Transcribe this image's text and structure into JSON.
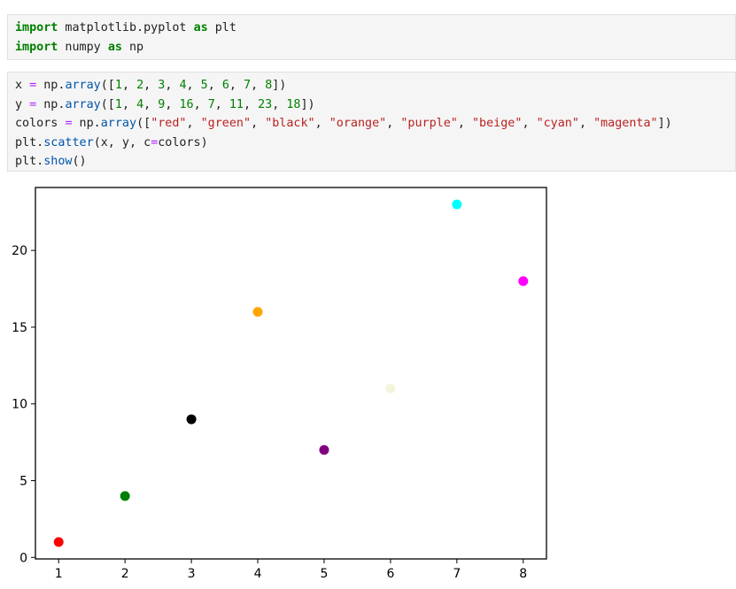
{
  "cells": [
    {
      "lines": [
        [
          {
            "t": "kw",
            "v": "import"
          },
          {
            "t": "plain",
            "v": " matplotlib.pyplot "
          },
          {
            "t": "kw",
            "v": "as"
          },
          {
            "t": "plain",
            "v": " plt"
          }
        ],
        [
          {
            "t": "kw",
            "v": "import"
          },
          {
            "t": "plain",
            "v": " numpy "
          },
          {
            "t": "kw",
            "v": "as"
          },
          {
            "t": "plain",
            "v": " np"
          }
        ]
      ]
    },
    {
      "lines": [
        [
          {
            "t": "plain",
            "v": "x "
          },
          {
            "t": "op",
            "v": "="
          },
          {
            "t": "plain",
            "v": " np."
          },
          {
            "t": "fn",
            "v": "array"
          },
          {
            "t": "plain",
            "v": "(["
          },
          {
            "t": "num",
            "v": "1"
          },
          {
            "t": "plain",
            "v": ", "
          },
          {
            "t": "num",
            "v": "2"
          },
          {
            "t": "plain",
            "v": ", "
          },
          {
            "t": "num",
            "v": "3"
          },
          {
            "t": "plain",
            "v": ", "
          },
          {
            "t": "num",
            "v": "4"
          },
          {
            "t": "plain",
            "v": ", "
          },
          {
            "t": "num",
            "v": "5"
          },
          {
            "t": "plain",
            "v": ", "
          },
          {
            "t": "num",
            "v": "6"
          },
          {
            "t": "plain",
            "v": ", "
          },
          {
            "t": "num",
            "v": "7"
          },
          {
            "t": "plain",
            "v": ", "
          },
          {
            "t": "num",
            "v": "8"
          },
          {
            "t": "plain",
            "v": "])"
          }
        ],
        [
          {
            "t": "plain",
            "v": "y "
          },
          {
            "t": "op",
            "v": "="
          },
          {
            "t": "plain",
            "v": " np."
          },
          {
            "t": "fn",
            "v": "array"
          },
          {
            "t": "plain",
            "v": "(["
          },
          {
            "t": "num",
            "v": "1"
          },
          {
            "t": "plain",
            "v": ", "
          },
          {
            "t": "num",
            "v": "4"
          },
          {
            "t": "plain",
            "v": ", "
          },
          {
            "t": "num",
            "v": "9"
          },
          {
            "t": "plain",
            "v": ", "
          },
          {
            "t": "num",
            "v": "16"
          },
          {
            "t": "plain",
            "v": ", "
          },
          {
            "t": "num",
            "v": "7"
          },
          {
            "t": "plain",
            "v": ", "
          },
          {
            "t": "num",
            "v": "11"
          },
          {
            "t": "plain",
            "v": ", "
          },
          {
            "t": "num",
            "v": "23"
          },
          {
            "t": "plain",
            "v": ", "
          },
          {
            "t": "num",
            "v": "18"
          },
          {
            "t": "plain",
            "v": "])"
          }
        ],
        [
          {
            "t": "plain",
            "v": "colors "
          },
          {
            "t": "op",
            "v": "="
          },
          {
            "t": "plain",
            "v": " np."
          },
          {
            "t": "fn",
            "v": "array"
          },
          {
            "t": "plain",
            "v": "(["
          },
          {
            "t": "str",
            "v": "\"red\""
          },
          {
            "t": "plain",
            "v": ", "
          },
          {
            "t": "str",
            "v": "\"green\""
          },
          {
            "t": "plain",
            "v": ", "
          },
          {
            "t": "str",
            "v": "\"black\""
          },
          {
            "t": "plain",
            "v": ", "
          },
          {
            "t": "str",
            "v": "\"orange\""
          },
          {
            "t": "plain",
            "v": ", "
          },
          {
            "t": "str",
            "v": "\"purple\""
          },
          {
            "t": "plain",
            "v": ", "
          },
          {
            "t": "str",
            "v": "\"beige\""
          },
          {
            "t": "plain",
            "v": ", "
          },
          {
            "t": "str",
            "v": "\"cyan\""
          },
          {
            "t": "plain",
            "v": ", "
          },
          {
            "t": "str",
            "v": "\"magenta\""
          },
          {
            "t": "plain",
            "v": "])"
          }
        ],
        [
          {
            "t": "plain",
            "v": "plt."
          },
          {
            "t": "fn",
            "v": "scatter"
          },
          {
            "t": "plain",
            "v": "(x, y, c"
          },
          {
            "t": "op",
            "v": "="
          },
          {
            "t": "plain",
            "v": "colors)"
          }
        ],
        [
          {
            "t": "plain",
            "v": "plt."
          },
          {
            "t": "fn",
            "v": "show"
          },
          {
            "t": "plain",
            "v": "()"
          }
        ]
      ]
    }
  ],
  "chart_data": {
    "type": "scatter",
    "x": [
      1,
      2,
      3,
      4,
      5,
      6,
      7,
      8
    ],
    "y": [
      1,
      4,
      9,
      16,
      7,
      11,
      23,
      18
    ],
    "colors": [
      "#ff0000",
      "#008000",
      "#000000",
      "#ffa500",
      "#800080",
      "#f5f5dc",
      "#00ffff",
      "#ff00ff"
    ],
    "xticks": [
      "1",
      "2",
      "3",
      "4",
      "5",
      "6",
      "7",
      "8"
    ],
    "yticks": [
      "0",
      "5",
      "10",
      "15",
      "20"
    ],
    "xlim": [
      0.65,
      8.35
    ],
    "ylim": [
      -0.1,
      24.1
    ],
    "grid": false
  }
}
